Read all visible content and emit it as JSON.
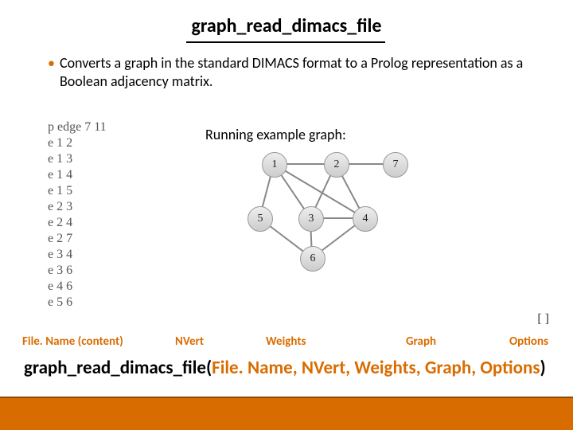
{
  "title": "graph_read_dimacs_file",
  "bullet": "Converts a graph in the standard DIMACS format to a Prolog representation as a Boolean adjacency matrix.",
  "running_label": "Running example graph:",
  "dimacs_lines": [
    "p edge 7 11",
    "e 1 2",
    "e 1 3",
    "e 1 4",
    "e 1 5",
    "e 2 3",
    "e 2 4",
    "e 2 7",
    "e 3 4",
    "e 3 6",
    "e 4 6",
    "e 5 6"
  ],
  "nodes": {
    "n1": "1",
    "n2": "2",
    "n3": "3",
    "n4": "4",
    "n5": "5",
    "n6": "6",
    "n7": "7"
  },
  "brackets": "[ ]",
  "labels": {
    "filename": "File. Name (content)",
    "nvert": "NVert",
    "weights": "Weights",
    "graph": "Graph",
    "options": "Options"
  },
  "sig": {
    "prefix": "graph_read_dimacs_file(",
    "args": "File. Name, NVert, Weights, Graph, Options",
    "suffix": ")"
  },
  "chart_data": {
    "type": "graph",
    "node_ids": [
      1,
      2,
      3,
      4,
      5,
      6,
      7
    ],
    "edges": [
      [
        1,
        2
      ],
      [
        1,
        3
      ],
      [
        1,
        4
      ],
      [
        1,
        5
      ],
      [
        2,
        3
      ],
      [
        2,
        4
      ],
      [
        2,
        7
      ],
      [
        3,
        4
      ],
      [
        3,
        6
      ],
      [
        4,
        6
      ],
      [
        5,
        6
      ]
    ]
  }
}
